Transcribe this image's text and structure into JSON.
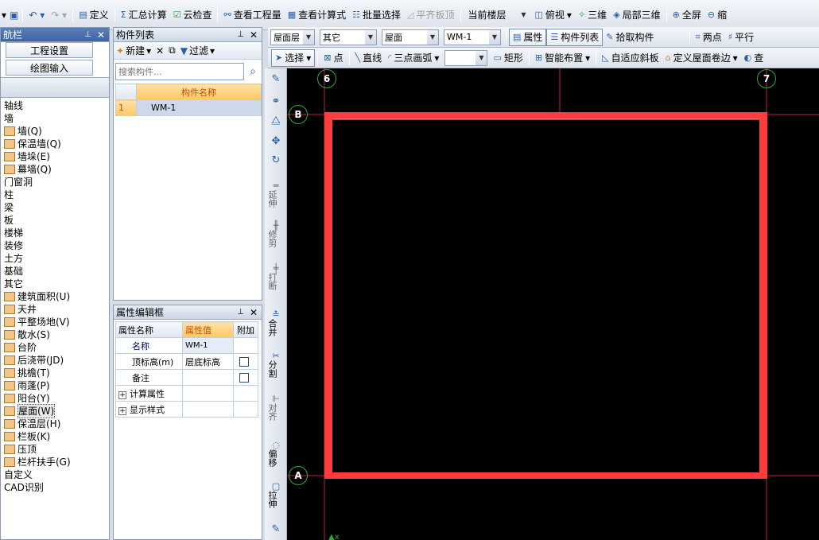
{
  "toolbar1": {
    "items": [
      "定义",
      "汇总计算",
      "云检查",
      "查看工程量",
      "查看计算式",
      "批量选择",
      "平齐板顶"
    ],
    "floor_select": "当前楼层",
    "view_items": [
      "俯视",
      "三维",
      "局部三维",
      "全屏",
      "缩"
    ]
  },
  "toolbar2": {
    "combo1": "屋面层",
    "combo2": "其它",
    "combo3": "屋面",
    "combo4": "WM-1",
    "attr_btn": "属性",
    "list_btn": "构件列表",
    "pick_btn": "拾取构件",
    "twopoint": "两点",
    "parallel": "平行"
  },
  "toolbar3": {
    "select": "选择",
    "point": "点",
    "line": "直线",
    "arc": "三点画弧",
    "combo": "",
    "rect": "矩形",
    "smart": "智能布置",
    "autoslope": "自适应斜板",
    "roofedge": "定义屋面卷边",
    "more": "查"
  },
  "nav": {
    "title": "航栏",
    "btn1": "工程设置",
    "btn2": "绘图输入",
    "tree": [
      {
        "label": "轴线",
        "icon": false
      },
      {
        "label": "墙",
        "icon": false
      },
      {
        "label": "墙(Q)",
        "icon": true
      },
      {
        "label": "保温墙(Q)",
        "icon": true
      },
      {
        "label": "墙垛(E)",
        "icon": true
      },
      {
        "label": "幕墙(Q)",
        "icon": true
      },
      {
        "label": "门窗洞",
        "icon": false
      },
      {
        "label": "柱",
        "icon": false
      },
      {
        "label": "梁",
        "icon": false
      },
      {
        "label": "板",
        "icon": false
      },
      {
        "label": "楼梯",
        "icon": false
      },
      {
        "label": "装修",
        "icon": false
      },
      {
        "label": "土方",
        "icon": false
      },
      {
        "label": "基础",
        "icon": false
      },
      {
        "label": "其它",
        "icon": false
      },
      {
        "label": "建筑面积(U)",
        "icon": true
      },
      {
        "label": "天井",
        "icon": true
      },
      {
        "label": "平整场地(V)",
        "icon": true
      },
      {
        "label": "散水(S)",
        "icon": true
      },
      {
        "label": "台阶",
        "icon": true
      },
      {
        "label": "后浇带(JD)",
        "icon": true
      },
      {
        "label": "挑檐(T)",
        "icon": true
      },
      {
        "label": "雨蓬(P)",
        "icon": true
      },
      {
        "label": "阳台(Y)",
        "icon": true
      },
      {
        "label": "屋面(W)",
        "icon": true,
        "selected": true
      },
      {
        "label": "保温层(H)",
        "icon": true
      },
      {
        "label": "栏板(K)",
        "icon": true
      },
      {
        "label": "压顶",
        "icon": true
      },
      {
        "label": "栏杆扶手(G)",
        "icon": true
      },
      {
        "label": "自定义",
        "icon": false
      },
      {
        "label": "CAD识别",
        "icon": false
      }
    ]
  },
  "complist": {
    "title": "构件列表",
    "new_btn": "新建",
    "filter_btn": "过滤",
    "search_placeholder": "搜索构件...",
    "col_header": "构件名称",
    "rows": [
      {
        "num": "1",
        "name": "WM-1"
      }
    ]
  },
  "props": {
    "title": "属性编辑框",
    "headers": [
      "属性名称",
      "属性值",
      "附加"
    ],
    "rows": [
      {
        "name": "名称",
        "value": "WM-1",
        "check": false
      },
      {
        "name": "顶标高(m)",
        "value": "层底标高",
        "check": true
      },
      {
        "name": "备注",
        "value": "",
        "check": true
      },
      {
        "name": "计算属性",
        "value": "",
        "check": false,
        "expand": true
      },
      {
        "name": "显示样式",
        "value": "",
        "check": false,
        "expand": true
      }
    ]
  },
  "vtoolbar": [
    "延伸",
    "修剪",
    "打断",
    "合并",
    "分割",
    "对齐",
    "偏移",
    "拉伸"
  ],
  "canvas": {
    "axis_labels": [
      "6",
      "7",
      "B",
      "A"
    ],
    "roof_color": "#ff3b3b",
    "axis_color": "#d9233c"
  }
}
